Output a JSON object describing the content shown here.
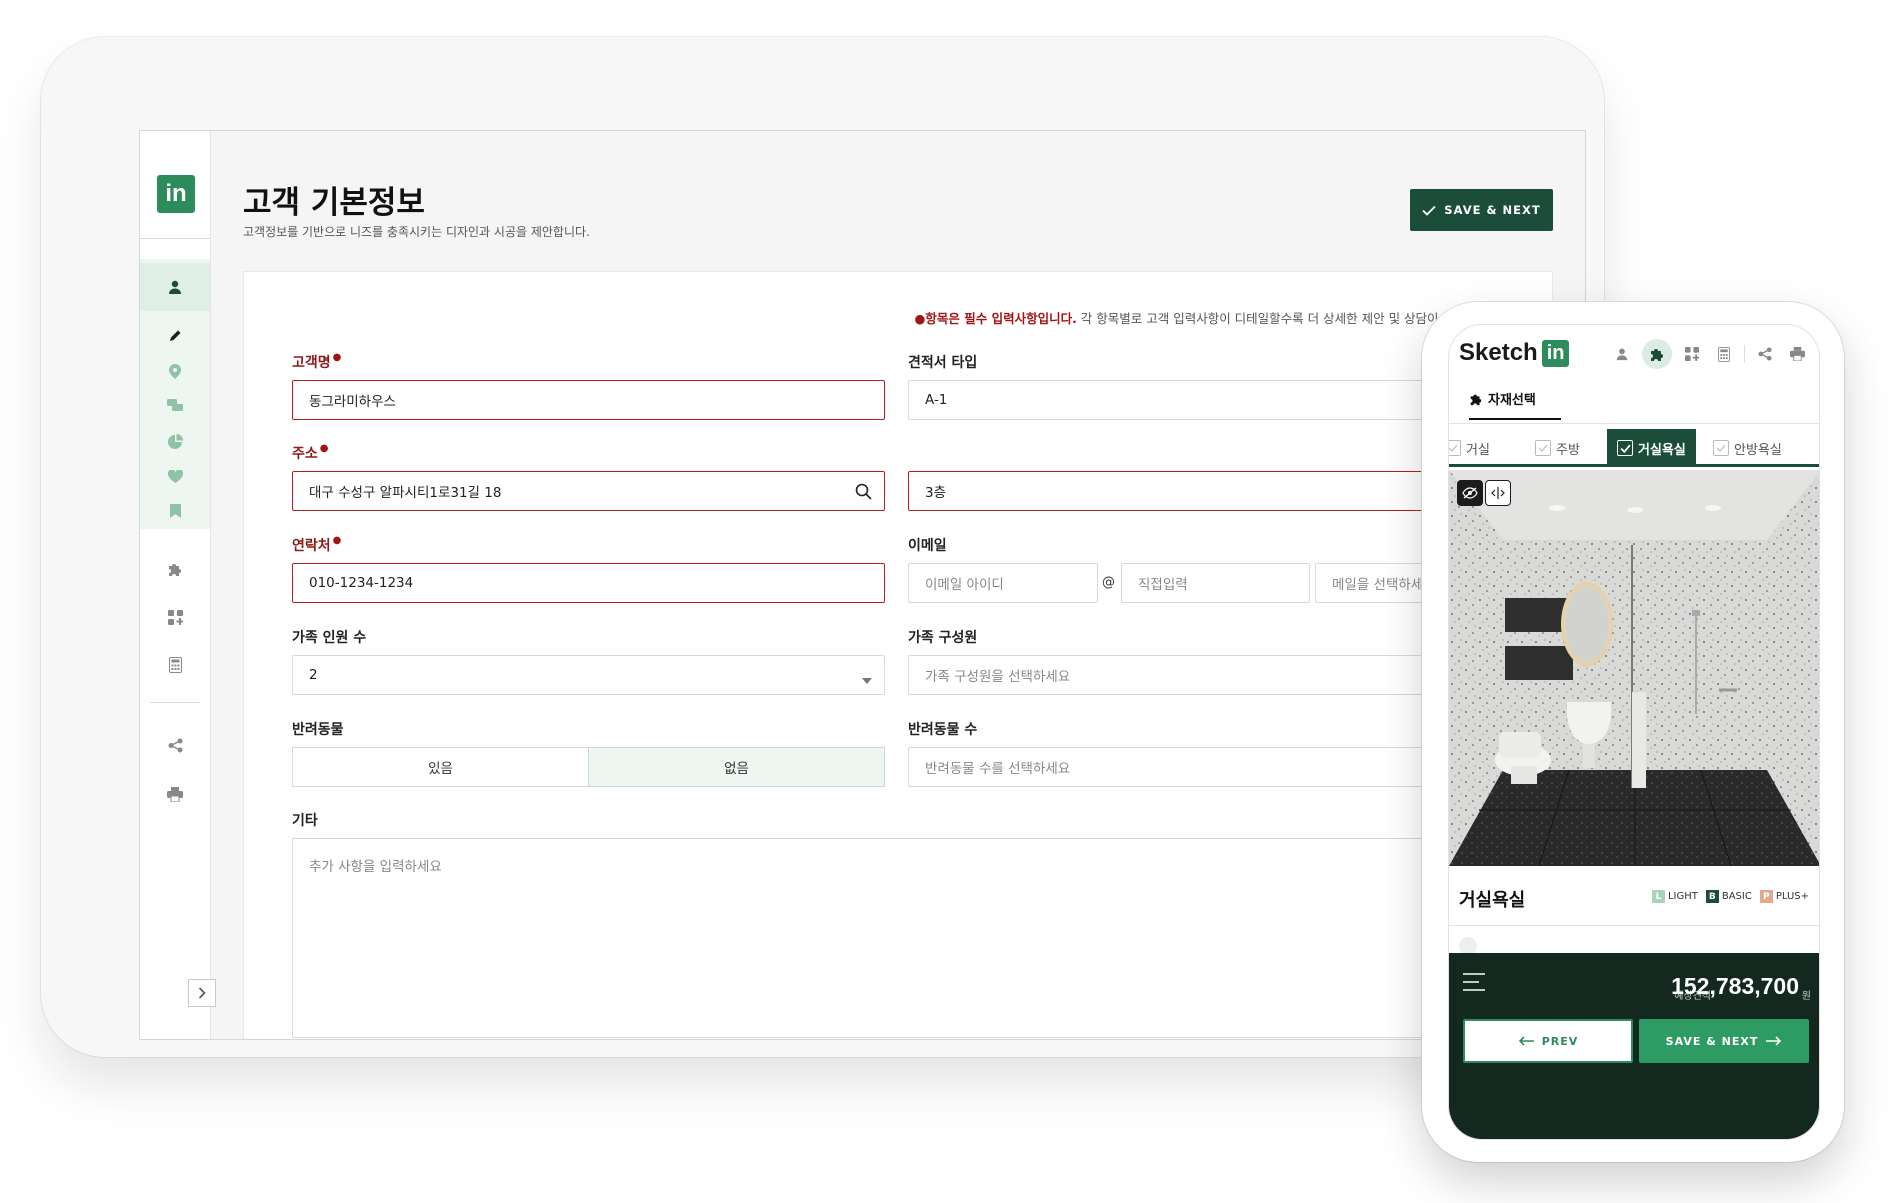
{
  "tablet": {
    "sidebar": {
      "logo": "in",
      "icons": [
        "user-icon",
        "pencil-icon",
        "location-pin-icon",
        "chat-icon",
        "pie-chart-icon",
        "heart-icon",
        "bookmark-icon",
        "puzzle-icon",
        "grid-plus-icon",
        "calculator-icon",
        "share-icon",
        "print-icon"
      ],
      "collapse_label": "›"
    },
    "header": {
      "title": "고객 기본정보",
      "subtitle": "고객정보를 기반으로 니즈를 충족시키는 디자인과 시공을 제안합니다.",
      "save_label": "SAVE & NEXT"
    },
    "form": {
      "notice_bullet": "●",
      "notice_required": "항목은 필수 입력사항입니다.",
      "notice_rest": " 각 항목별로 고객 입력사항이 디테일할수록 더 상세한 제안 및 상담이 가능합니다.",
      "required_mark": "●",
      "customer_name": {
        "label": "고객명",
        "value": "동그라미하우스"
      },
      "estimate_type": {
        "label": "견적서 타입",
        "value": "A-1"
      },
      "address": {
        "label": "주소",
        "value": "대구 수성구 알파시티1로31길 18",
        "detail": "3층"
      },
      "phone": {
        "label": "연락처",
        "value": "010-1234-1234"
      },
      "email": {
        "label": "이메일",
        "id_placeholder": "이메일 아이디",
        "at": "@",
        "domain_placeholder": "직접입력",
        "select_placeholder": "메일을 선택하세요"
      },
      "family_count": {
        "label": "가족 인원 수",
        "value": "2"
      },
      "family_members": {
        "label": "가족 구성원",
        "placeholder": "가족 구성원을 선택하세요"
      },
      "pets": {
        "label": "반려동물",
        "options": [
          "있음",
          "없음"
        ],
        "selected": "없음"
      },
      "pet_count": {
        "label": "반려동물 수",
        "placeholder": "반려동물 수를 선택하세요"
      },
      "other": {
        "label": "기타",
        "placeholder": "추가 사항을 입력하세요"
      }
    }
  },
  "phone": {
    "logo_text": "Sketch",
    "logo_badge": "in",
    "header_icons": [
      "user-icon",
      "puzzle-icon",
      "grid-plus-icon",
      "calculator-icon",
      "share-icon",
      "print-icon"
    ],
    "tab": "자재선택",
    "rooms": [
      {
        "label": "거실",
        "checked": false
      },
      {
        "label": "주방",
        "checked": false
      },
      {
        "label": "거실욕실",
        "checked": true
      },
      {
        "label": "안방욕실",
        "checked": false
      }
    ],
    "room_title": "거실욕실",
    "grades": [
      {
        "badge": "L",
        "label": "LIGHT",
        "color": "#a9d3bd"
      },
      {
        "badge": "B",
        "label": "BASIC",
        "color": "#1b4d3a"
      },
      {
        "badge": "P",
        "label": "PLUS+",
        "color": "#e3a98c"
      }
    ],
    "estimate_label": "예상견적",
    "estimate_value": "152,783,700",
    "estimate_unit": "원",
    "prev_label": "PREV",
    "next_label": "SAVE & NEXT"
  },
  "colors": {
    "brand": "#2e8b5b",
    "dark": "#1b4d3a",
    "error": "#b01f24",
    "required": "#a31515"
  }
}
